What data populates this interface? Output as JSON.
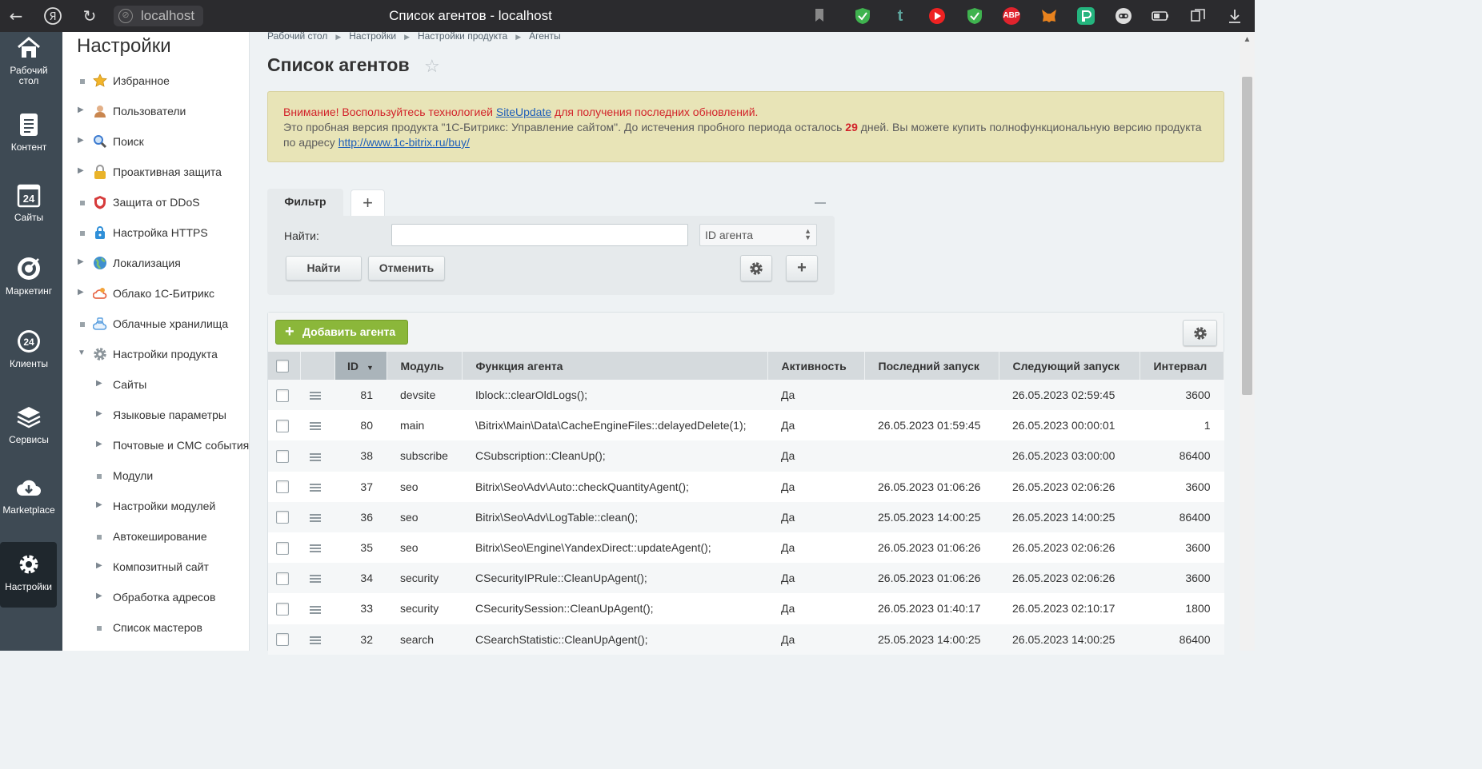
{
  "browser": {
    "url": "localhost",
    "tab_title": "Список агентов - localhost",
    "ext_abp": "ABP",
    "ext_t": "t"
  },
  "left_nav": [
    {
      "label": "Рабочий стол",
      "icon": "home-icon"
    },
    {
      "label": "Контент",
      "icon": "document-icon"
    },
    {
      "label": "Сайты",
      "icon": "calendar-24-icon"
    },
    {
      "label": "Маркетинг",
      "icon": "target-icon"
    },
    {
      "label": "Клиенты",
      "icon": "clients-24-icon"
    },
    {
      "label": "Сервисы",
      "icon": "layers-icon"
    },
    {
      "label": "Marketplace",
      "icon": "cloud-download-icon"
    },
    {
      "label": "Настройки",
      "icon": "gear-icon"
    }
  ],
  "settings": {
    "title": "Настройки",
    "items": [
      {
        "label": "Избранное",
        "marker": "dot",
        "icon": "star-icon",
        "color": "#f3b52a"
      },
      {
        "label": "Пользователи",
        "marker": "arrow",
        "icon": "user-icon",
        "color": "#c9864f"
      },
      {
        "label": "Поиск",
        "marker": "arrow",
        "icon": "search-icon",
        "color": "#3d7bd0"
      },
      {
        "label": "Проактивная защита",
        "marker": "arrow",
        "icon": "lock-icon",
        "color": "#e9b32a"
      },
      {
        "label": "Защита от DDoS",
        "marker": "dot",
        "icon": "shield-icon",
        "color": "#d63b3b"
      },
      {
        "label": "Настройка HTTPS",
        "marker": "dot",
        "icon": "https-lock-icon",
        "color": "#2f8fd8"
      },
      {
        "label": "Локализация",
        "marker": "arrow",
        "icon": "globe-icon",
        "color": "#3f8fd0"
      },
      {
        "label": "Облако 1С-Битрикс",
        "marker": "arrow",
        "icon": "cloud-icon",
        "color": "#e86a4a"
      },
      {
        "label": "Облачные хранилища",
        "marker": "dot",
        "icon": "cloud-storage-icon",
        "color": "#5ba0e0"
      },
      {
        "label": "Настройки продукта",
        "marker": "open",
        "icon": "gear-icon",
        "color": "#8d969c"
      }
    ],
    "sub_items": [
      {
        "label": "Сайты",
        "marker": "arrow"
      },
      {
        "label": "Языковые параметры",
        "marker": "arrow"
      },
      {
        "label": "Почтовые и СМС события",
        "marker": "arrow"
      },
      {
        "label": "Модули",
        "marker": "dot"
      },
      {
        "label": "Настройки модулей",
        "marker": "arrow"
      },
      {
        "label": "Автокеширование",
        "marker": "dot"
      },
      {
        "label": "Композитный сайт",
        "marker": "arrow"
      },
      {
        "label": "Обработка адресов",
        "marker": "arrow"
      },
      {
        "label": "Список мастеров",
        "marker": "dot"
      }
    ]
  },
  "breadcrumb": [
    "Рабочий стол",
    "Настройки",
    "Настройки продукта",
    "Агенты"
  ],
  "page_title": "Список агентов",
  "alert": {
    "warn_prefix": "Внимание!",
    "warn_text1": " Воспользуйтесь технологией ",
    "warn_link": "SiteUpdate",
    "warn_text2": " для получения последних обновлений.",
    "trial_text1": "Это пробная версия продукта \"1С-Битрикс: Управление сайтом\". До истечения пробного периода осталось ",
    "trial_days": "29",
    "trial_text2": " дней. Вы можете купить полнофункциональную версию продукта",
    "trial_text3": "по адресу ",
    "trial_link": "http://www.1c-bitrix.ru/buy/"
  },
  "filter": {
    "tab_label": "Фильтр",
    "find_label": "Найти:",
    "find_value": "",
    "select_value": "ID агента",
    "find_button": "Найти",
    "cancel_button": "Отменить"
  },
  "toolbar": {
    "add_agent": "Добавить агента"
  },
  "table": {
    "columns": {
      "id": "ID",
      "module": "Модуль",
      "function": "Функция агента",
      "active": "Активность",
      "last_run": "Последний запуск",
      "next_run": "Следующий запуск",
      "interval": "Интервал"
    },
    "rows": [
      {
        "id": "81",
        "module": "devsite",
        "function": "Iblock::clearOldLogs();",
        "active": "Да",
        "last_run": "",
        "next_run": "26.05.2023 02:59:45",
        "interval": "3600"
      },
      {
        "id": "80",
        "module": "main",
        "function": "\\Bitrix\\Main\\Data\\CacheEngineFiles::delayedDelete(1);",
        "active": "Да",
        "last_run": "26.05.2023 01:59:45",
        "next_run": "26.05.2023 00:00:01",
        "interval": "1"
      },
      {
        "id": "38",
        "module": "subscribe",
        "function": "CSubscription::CleanUp();",
        "active": "Да",
        "last_run": "",
        "next_run": "26.05.2023 03:00:00",
        "interval": "86400"
      },
      {
        "id": "37",
        "module": "seo",
        "function": "Bitrix\\Seo\\Adv\\Auto::checkQuantityAgent();",
        "active": "Да",
        "last_run": "26.05.2023 01:06:26",
        "next_run": "26.05.2023 02:06:26",
        "interval": "3600"
      },
      {
        "id": "36",
        "module": "seo",
        "function": "Bitrix\\Seo\\Adv\\LogTable::clean();",
        "active": "Да",
        "last_run": "25.05.2023 14:00:25",
        "next_run": "26.05.2023 14:00:25",
        "interval": "86400"
      },
      {
        "id": "35",
        "module": "seo",
        "function": "Bitrix\\Seo\\Engine\\YandexDirect::updateAgent();",
        "active": "Да",
        "last_run": "26.05.2023 01:06:26",
        "next_run": "26.05.2023 02:06:26",
        "interval": "3600"
      },
      {
        "id": "34",
        "module": "security",
        "function": "CSecurityIPRule::CleanUpAgent();",
        "active": "Да",
        "last_run": "26.05.2023 01:06:26",
        "next_run": "26.05.2023 02:06:26",
        "interval": "3600"
      },
      {
        "id": "33",
        "module": "security",
        "function": "CSecuritySession::CleanUpAgent();",
        "active": "Да",
        "last_run": "26.05.2023 01:40:17",
        "next_run": "26.05.2023 02:10:17",
        "interval": "1800"
      },
      {
        "id": "32",
        "module": "search",
        "function": "CSearchStatistic::CleanUpAgent();",
        "active": "Да",
        "last_run": "25.05.2023 14:00:25",
        "next_run": "26.05.2023 14:00:25",
        "interval": "86400"
      }
    ]
  }
}
